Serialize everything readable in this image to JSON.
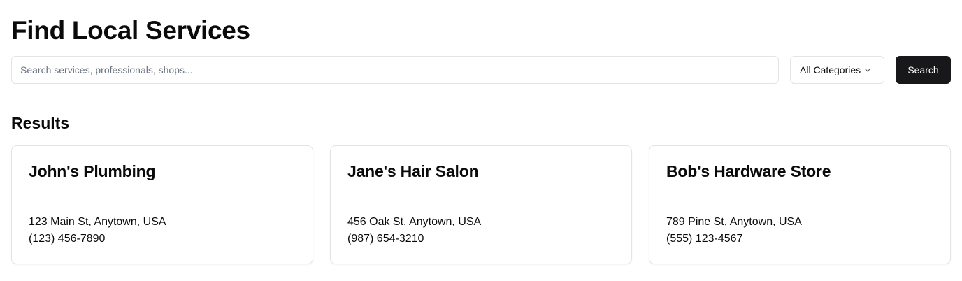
{
  "page": {
    "title": "Find Local Services"
  },
  "search": {
    "placeholder": "Search services, professionals, shops...",
    "value": "",
    "category_selected": "All Categories",
    "button_label": "Search"
  },
  "results": {
    "heading": "Results",
    "items": [
      {
        "name": "John's Plumbing",
        "address": "123 Main St, Anytown, USA",
        "phone": "(123) 456-7890"
      },
      {
        "name": "Jane's Hair Salon",
        "address": "456 Oak St, Anytown, USA",
        "phone": "(987) 654-3210"
      },
      {
        "name": "Bob's Hardware Store",
        "address": "789 Pine St, Anytown, USA",
        "phone": "(555) 123-4567"
      }
    ]
  },
  "icons": {
    "category_dropdown": "chevron-down-icon"
  },
  "colors": {
    "primary_button": "#18181b",
    "border": "#e4e4e7",
    "text": "#0a0a0a",
    "placeholder": "#6b7280"
  }
}
